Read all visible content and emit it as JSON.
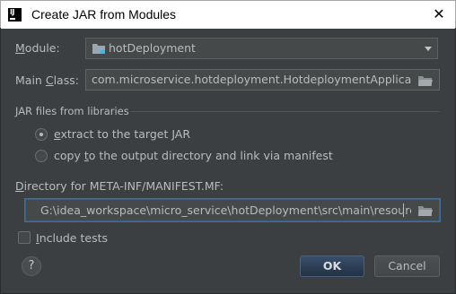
{
  "window": {
    "title": "Create JAR from Modules",
    "close_symbol": "✕"
  },
  "module": {
    "label": "Module:",
    "value": "hotDeployment"
  },
  "main_class": {
    "label": "Main Class:",
    "value": "com.microservice.hotdeployment.HotdeploymentApplication"
  },
  "jar_files": {
    "group_label": "JAR files from libraries",
    "options": [
      {
        "label": "extract to the target JAR",
        "selected": true
      },
      {
        "label": "copy to the output directory and link via manifest",
        "selected": false
      }
    ]
  },
  "manifest": {
    "label": "Directory for META-INF/MANIFEST.MF:",
    "value": "G:\\idea_workspace\\micro_service\\hotDeployment\\src\\main\\resources"
  },
  "include_tests": {
    "label": "Include tests",
    "checked": false
  },
  "buttons": {
    "help": "?",
    "ok": "OK",
    "cancel": "Cancel"
  }
}
